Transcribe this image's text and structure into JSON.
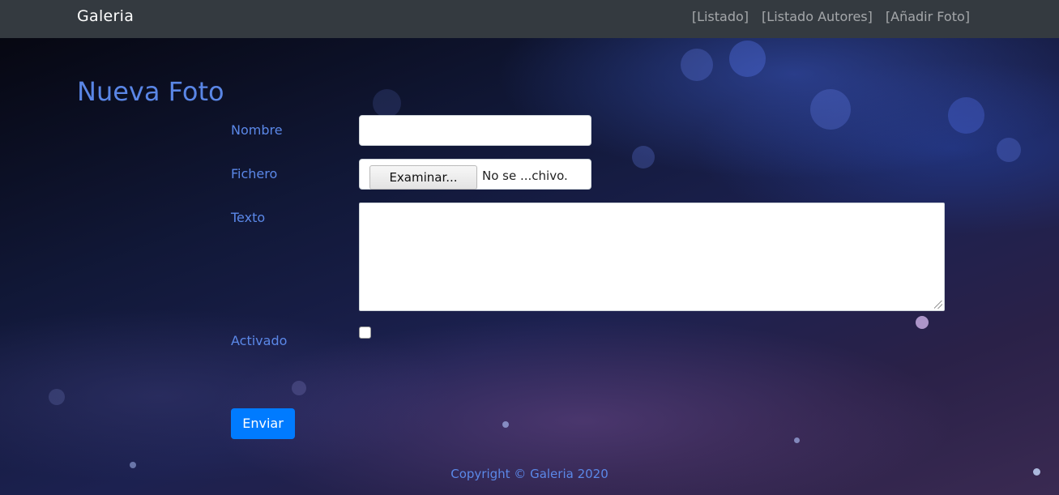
{
  "navbar": {
    "brand": "Galeria",
    "links": [
      "[Listado]",
      "[Listado Autores]",
      "[Añadir Foto]"
    ]
  },
  "page": {
    "title": "Nueva Foto"
  },
  "form": {
    "nombre_label": "Nombre",
    "nombre_value": "",
    "fichero_label": "Fichero",
    "file_button_label": "Examinar...",
    "file_name": "No se ...chivo.",
    "texto_label": "Texto",
    "texto_value": "",
    "activado_label": "Activado",
    "activado_checked": false,
    "submit_label": "Enviar"
  },
  "footer": {
    "text": "Copyright © Galeria 2020"
  },
  "colors": {
    "navbar_bg": "#343a40",
    "accent": "#5b88e8",
    "button_primary": "#007bff"
  }
}
